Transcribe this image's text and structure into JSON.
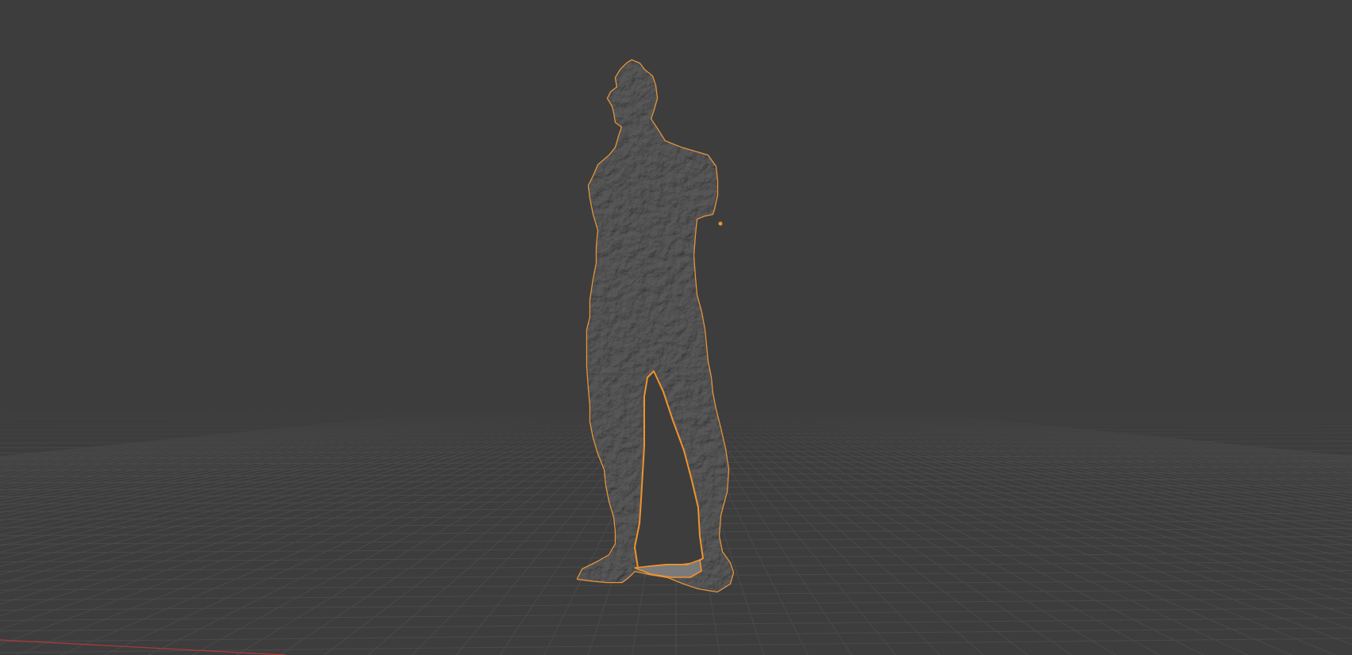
{
  "viewport": {
    "background_color": "#3d3d3d",
    "grid_color": "#4a4a4a",
    "x_axis_color": "#b03a3a",
    "selection_outline_color": "#f0932f",
    "mesh_color": "#8c8c8c",
    "mesh_shade_color": "#7a7a7a"
  },
  "scene": {
    "selected_object_icon": "mesh-object-icon"
  }
}
